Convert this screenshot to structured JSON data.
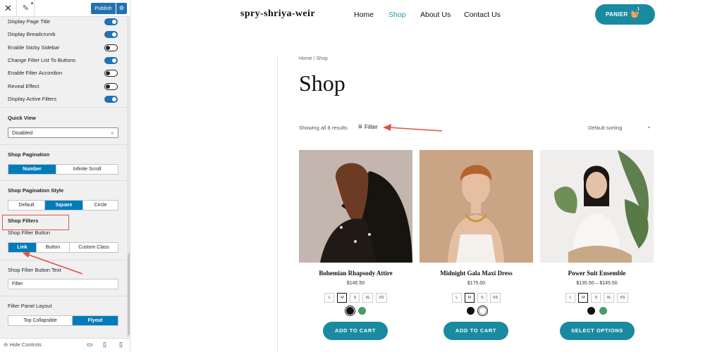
{
  "customizer": {
    "publish_label": "Publish",
    "toggles": [
      {
        "label": "Display Page Title",
        "on": true
      },
      {
        "label": "Display Breadcrumb",
        "on": true
      },
      {
        "label": "Enable Sticky Sidebar",
        "on": false
      },
      {
        "label": "Change Filter List To Buttons",
        "on": true
      },
      {
        "label": "Enable Filter Accordion",
        "on": false
      },
      {
        "label": "Reveal Effect",
        "on": false
      },
      {
        "label": "Display Active Filters",
        "on": true
      }
    ],
    "quick_view": {
      "title": "Quick View",
      "value": "Disabled"
    },
    "pagination": {
      "title": "Shop Pagination",
      "options": [
        "Number",
        "Infinite Scroll"
      ],
      "active": 0
    },
    "pagination_style": {
      "title": "Shop Pagination Style",
      "options": [
        "Default",
        "Square",
        "Circle"
      ],
      "active": 1
    },
    "shop_filters": {
      "title": "Shop Filters",
      "button_label": "Shop Filter Button",
      "button_options": [
        "Link",
        "Button",
        "Custom Class"
      ],
      "button_active": 0,
      "text_label": "Shop Filter Button Text",
      "text_value": "Filter"
    },
    "filter_panel": {
      "title": "Filter Panel Layout",
      "options": [
        "Top Collapsible",
        "Flyout"
      ],
      "active": 1
    },
    "hide_controls": "Hide Controls",
    "colors": {
      "accent": "#007cba",
      "annotation": "#e0533f"
    }
  },
  "site": {
    "title": "spry-shriya-weir",
    "nav": [
      {
        "label": "Home",
        "active": false
      },
      {
        "label": "Shop",
        "active": true
      },
      {
        "label": "About Us",
        "active": false
      },
      {
        "label": "Contact Us",
        "active": false
      }
    ],
    "cart_label": "PANIER",
    "cart_count": "1",
    "breadcrumb": "Home / Shop",
    "page_title": "Shop",
    "result_count": "Showing all 8 results",
    "filter_label": "Filter",
    "sorting": "Default sorting",
    "colors": {
      "brand": "#1a8aa1",
      "nav_active": "#1e98aa"
    },
    "products": [
      {
        "name": "Bohemian Rhapsody Attire",
        "price": "$145.50",
        "sizes": [
          "L",
          "M",
          "S",
          "XL",
          "XS"
        ],
        "selected_size": "M",
        "swatches": [
          "#111111",
          "#4a9a6a"
        ],
        "button": "ADD TO CART"
      },
      {
        "name": "Midnight Gala Maxi Dress",
        "price": "$175.00",
        "sizes": [
          "L",
          "M",
          "S",
          "XS"
        ],
        "selected_size": "M",
        "swatches": [
          "#111111",
          "#ffffff"
        ],
        "button": "ADD TO CART"
      },
      {
        "name": "Power Suit Ensemble",
        "price": "$135.50 – $145.50",
        "sizes": [
          "L",
          "M",
          "S",
          "XL",
          "XS"
        ],
        "selected_size": "M",
        "swatches": [
          "#111111",
          "#4a9a6a"
        ],
        "button": "SELECT OPTIONS"
      }
    ]
  }
}
